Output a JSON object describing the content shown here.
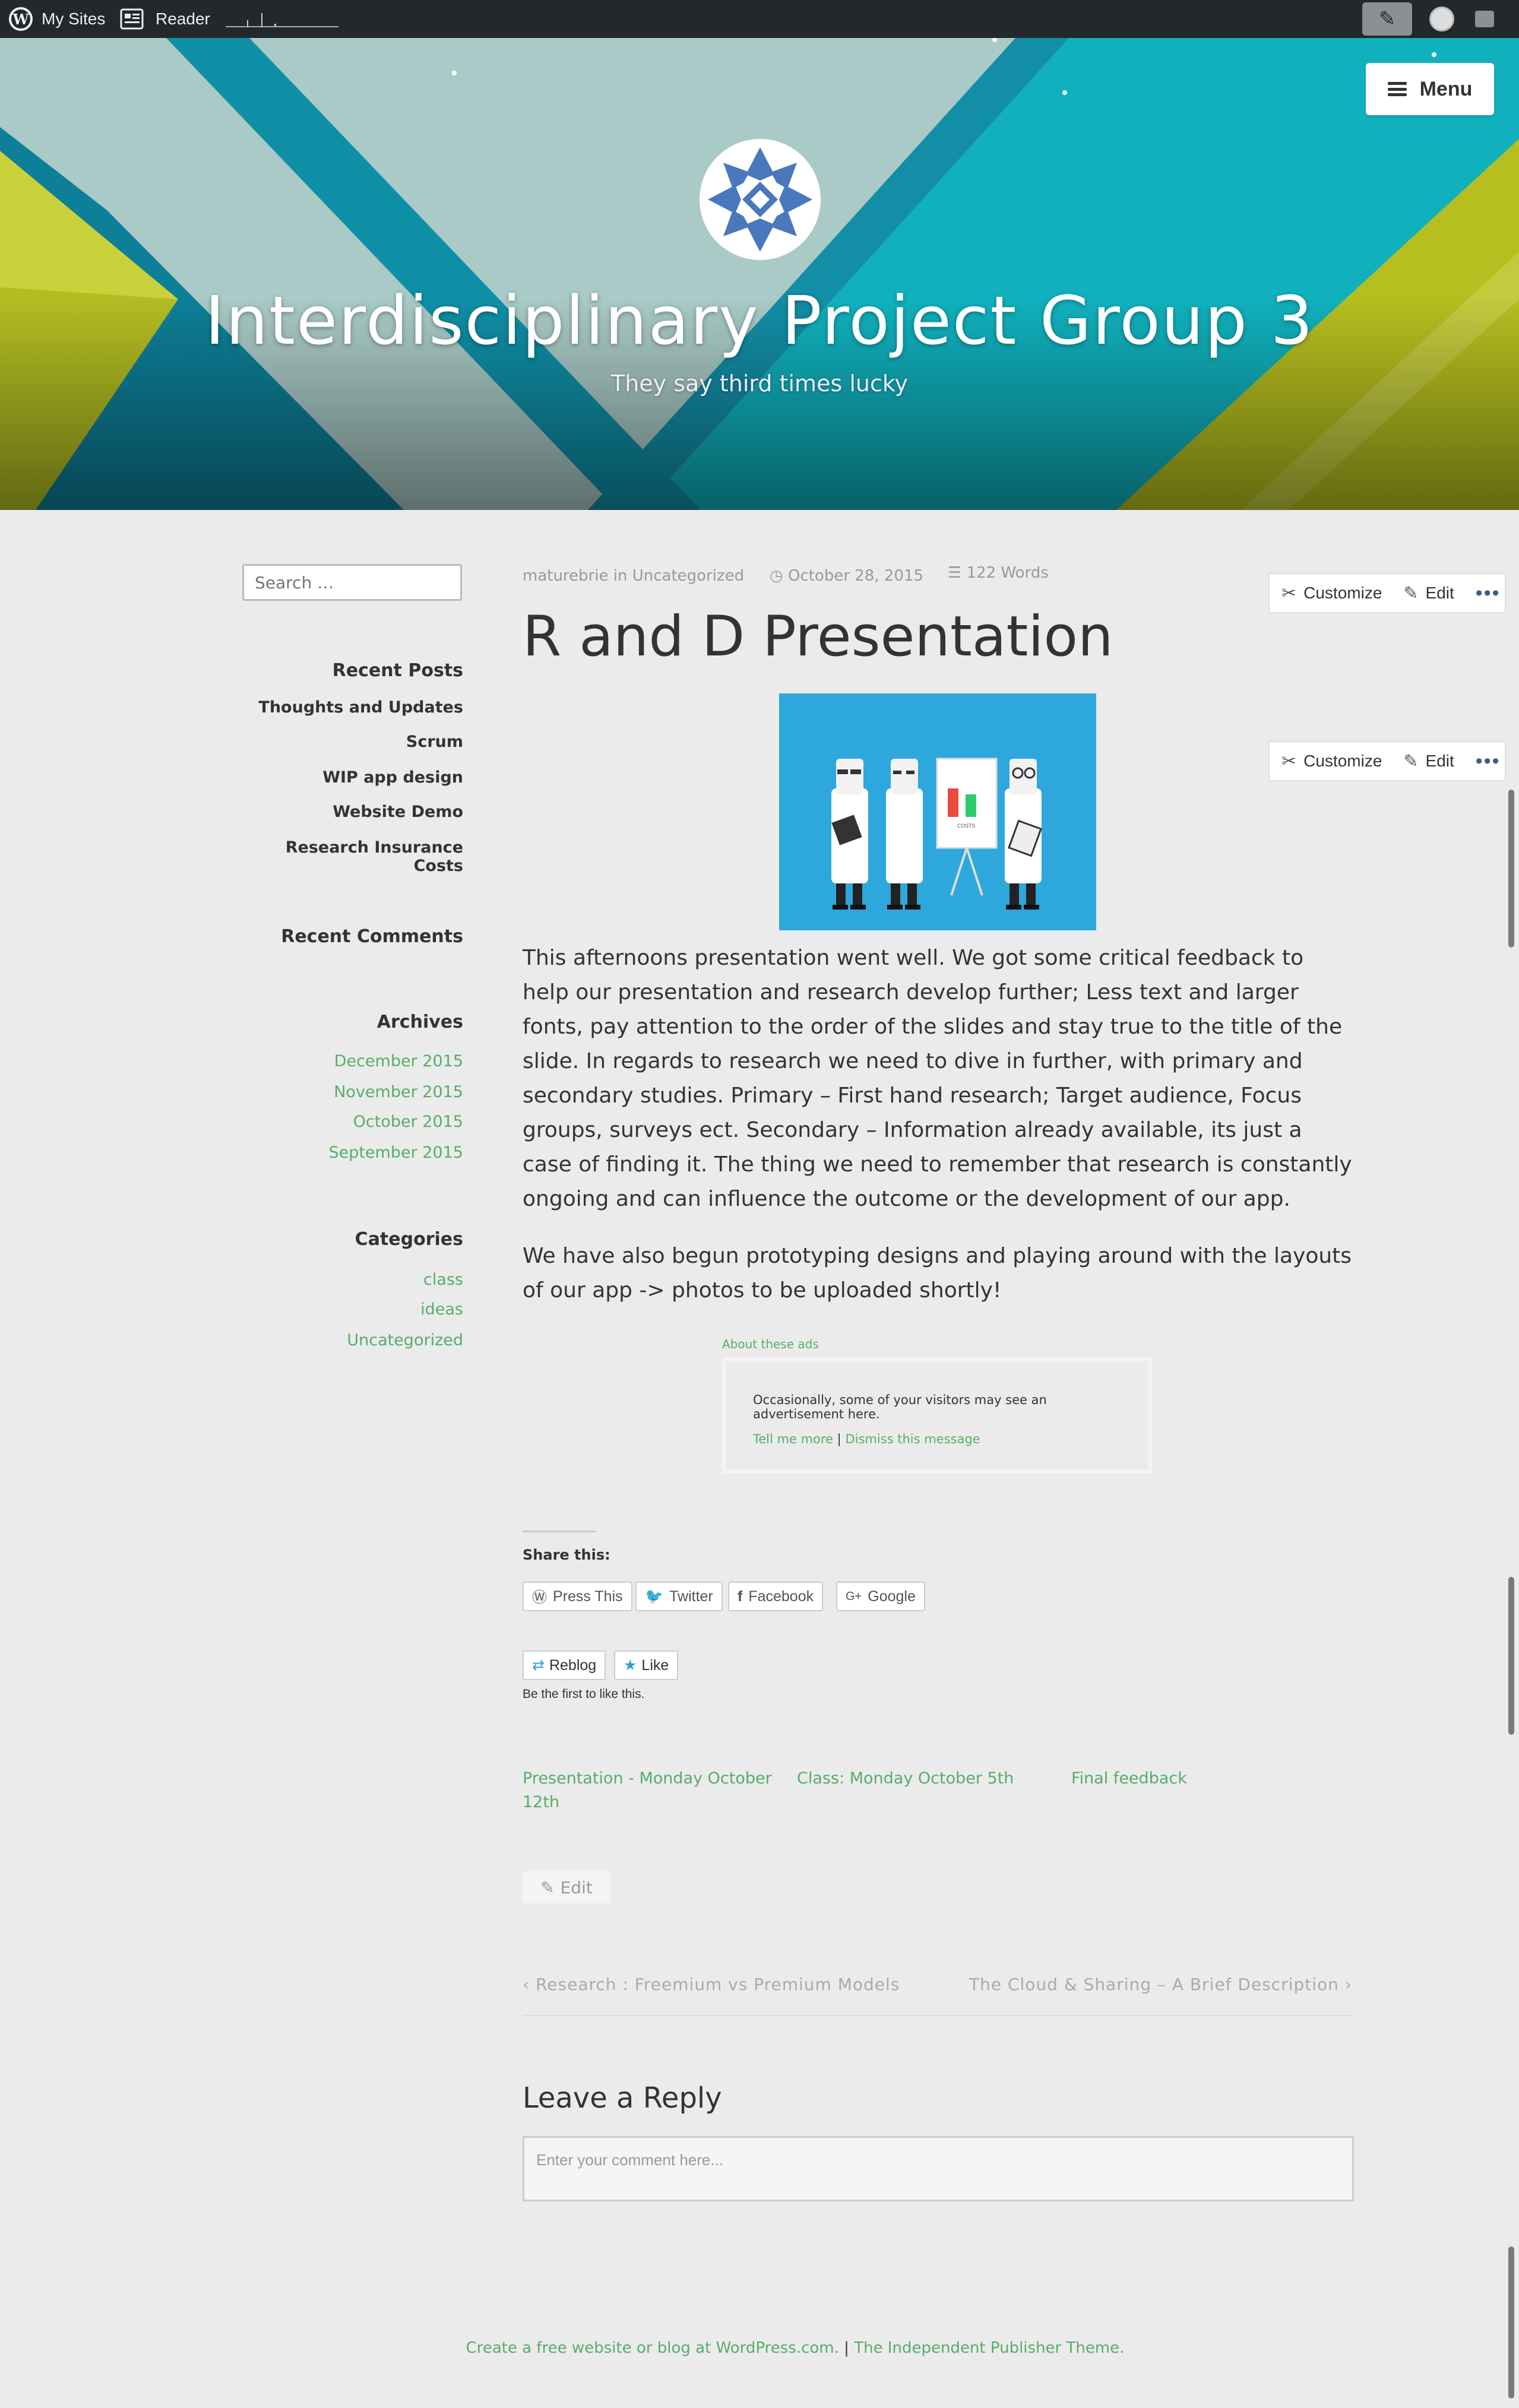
{
  "adminbar": {
    "my_sites": "My Sites",
    "reader": "Reader"
  },
  "header": {
    "menu_label": "Menu",
    "site_title": "Interdisciplinary Project Group 3",
    "site_description": "They say third times lucky"
  },
  "sidebar": {
    "search_placeholder": "Search …",
    "recent_posts_title": "Recent Posts",
    "recent_posts": [
      "Thoughts and Updates",
      "Scrum",
      "WIP app design",
      "Website Demo",
      "Research Insurance Costs"
    ],
    "recent_comments_title": "Recent Comments",
    "archives_title": "Archives",
    "archives": [
      "December 2015",
      "November 2015",
      "October 2015",
      "September 2015"
    ],
    "categories_title": "Categories",
    "categories": [
      "class",
      "ideas",
      "Uncategorized"
    ]
  },
  "post": {
    "author": "maturebrie",
    "in_word": "in",
    "category": "Uncategorized",
    "date": "October 28, 2015",
    "word_count": "122 Words",
    "title": "R and D Presentation",
    "customize_label": "Customize",
    "edit_label": "Edit",
    "paragraph1": "This afternoons presentation went well. We got some critical feedback to help our presentation and research develop further; Less text and larger fonts, pay attention to the order of the slides and stay true to the title of the slide. In regards to research we need to dive in further, with primary and secondary studies. Primary – First hand research; Target audience, Focus groups, surveys ect. Secondary – Information already available, its just a case of finding it. The thing we need to remember that research is constantly ongoing and can influence the outcome or the development of our app.",
    "paragraph2": "We have also begun prototyping designs and playing around with the layouts of our app -> photos to be uploaded shortly!",
    "image_board_text": "COSTS"
  },
  "ads": {
    "about_label": "About these ads",
    "message": "Occasionally, some of your visitors may see an advertisement here.",
    "tell_more": "Tell me more",
    "separator": "|",
    "dismiss": "Dismiss this message"
  },
  "share": {
    "title": "Share this:",
    "buttons": [
      "Press This",
      "Twitter",
      "Facebook",
      "Google"
    ],
    "reblog": "Reblog",
    "like": "Like",
    "like_text": "Be the first to like this."
  },
  "related": [
    "Presentation - Monday October 12th",
    "Class: Monday October 5th",
    "Final feedback"
  ],
  "post_edit_label": "Edit",
  "navigation": {
    "previous": "Research : Freemium vs Premium Models",
    "next": "The Cloud & Sharing – A Brief Description"
  },
  "reply": {
    "title": "Leave a Reply",
    "placeholder": "Enter your comment here..."
  },
  "footer": {
    "link1": "Create a free website or blog at WordPress.com.",
    "separator": "|",
    "link2": "The Independent Publisher Theme."
  },
  "colors": {
    "accent_green": "#57ad68",
    "adminbar": "#23282d",
    "image_bg": "#2ea7dc"
  }
}
